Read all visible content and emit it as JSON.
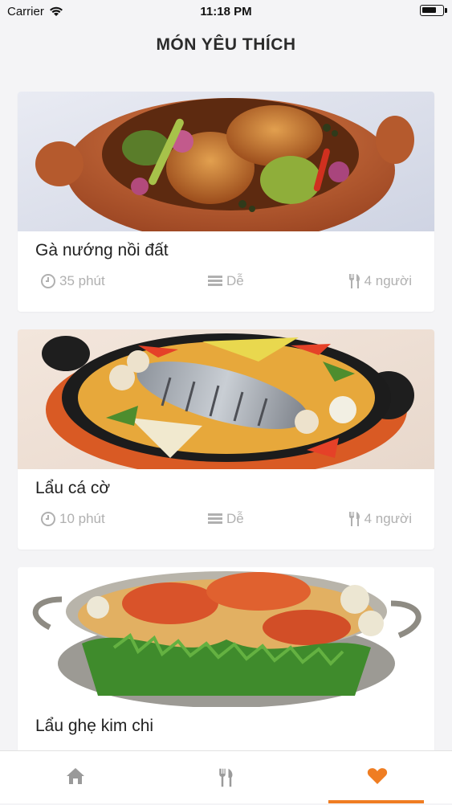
{
  "status_bar": {
    "carrier": "Carrier",
    "time": "11:18 PM",
    "battery_level": 0.75
  },
  "header": {
    "title": "MÓN YÊU THÍCH"
  },
  "recipes": [
    {
      "name": "Gà nướng nồi đất",
      "time": "35 phút",
      "difficulty": "Dễ",
      "servings": "4 người",
      "image": "claypot-roast-chicken"
    },
    {
      "name": "Lẩu cá cờ",
      "time": "10 phút",
      "difficulty": "Dễ",
      "servings": "4 người",
      "image": "fish-hotpot"
    },
    {
      "name": "Lẩu ghẹ kim chi",
      "time": "",
      "difficulty": "",
      "servings": "",
      "image": "crab-kimchi-hotpot"
    }
  ],
  "tabbar": {
    "items": [
      {
        "icon": "home-icon"
      },
      {
        "icon": "fork-knife-icon"
      },
      {
        "icon": "heart-icon",
        "active": true
      }
    ],
    "active_color": "#ef7d22",
    "inactive_color": "#9a9a9a"
  }
}
